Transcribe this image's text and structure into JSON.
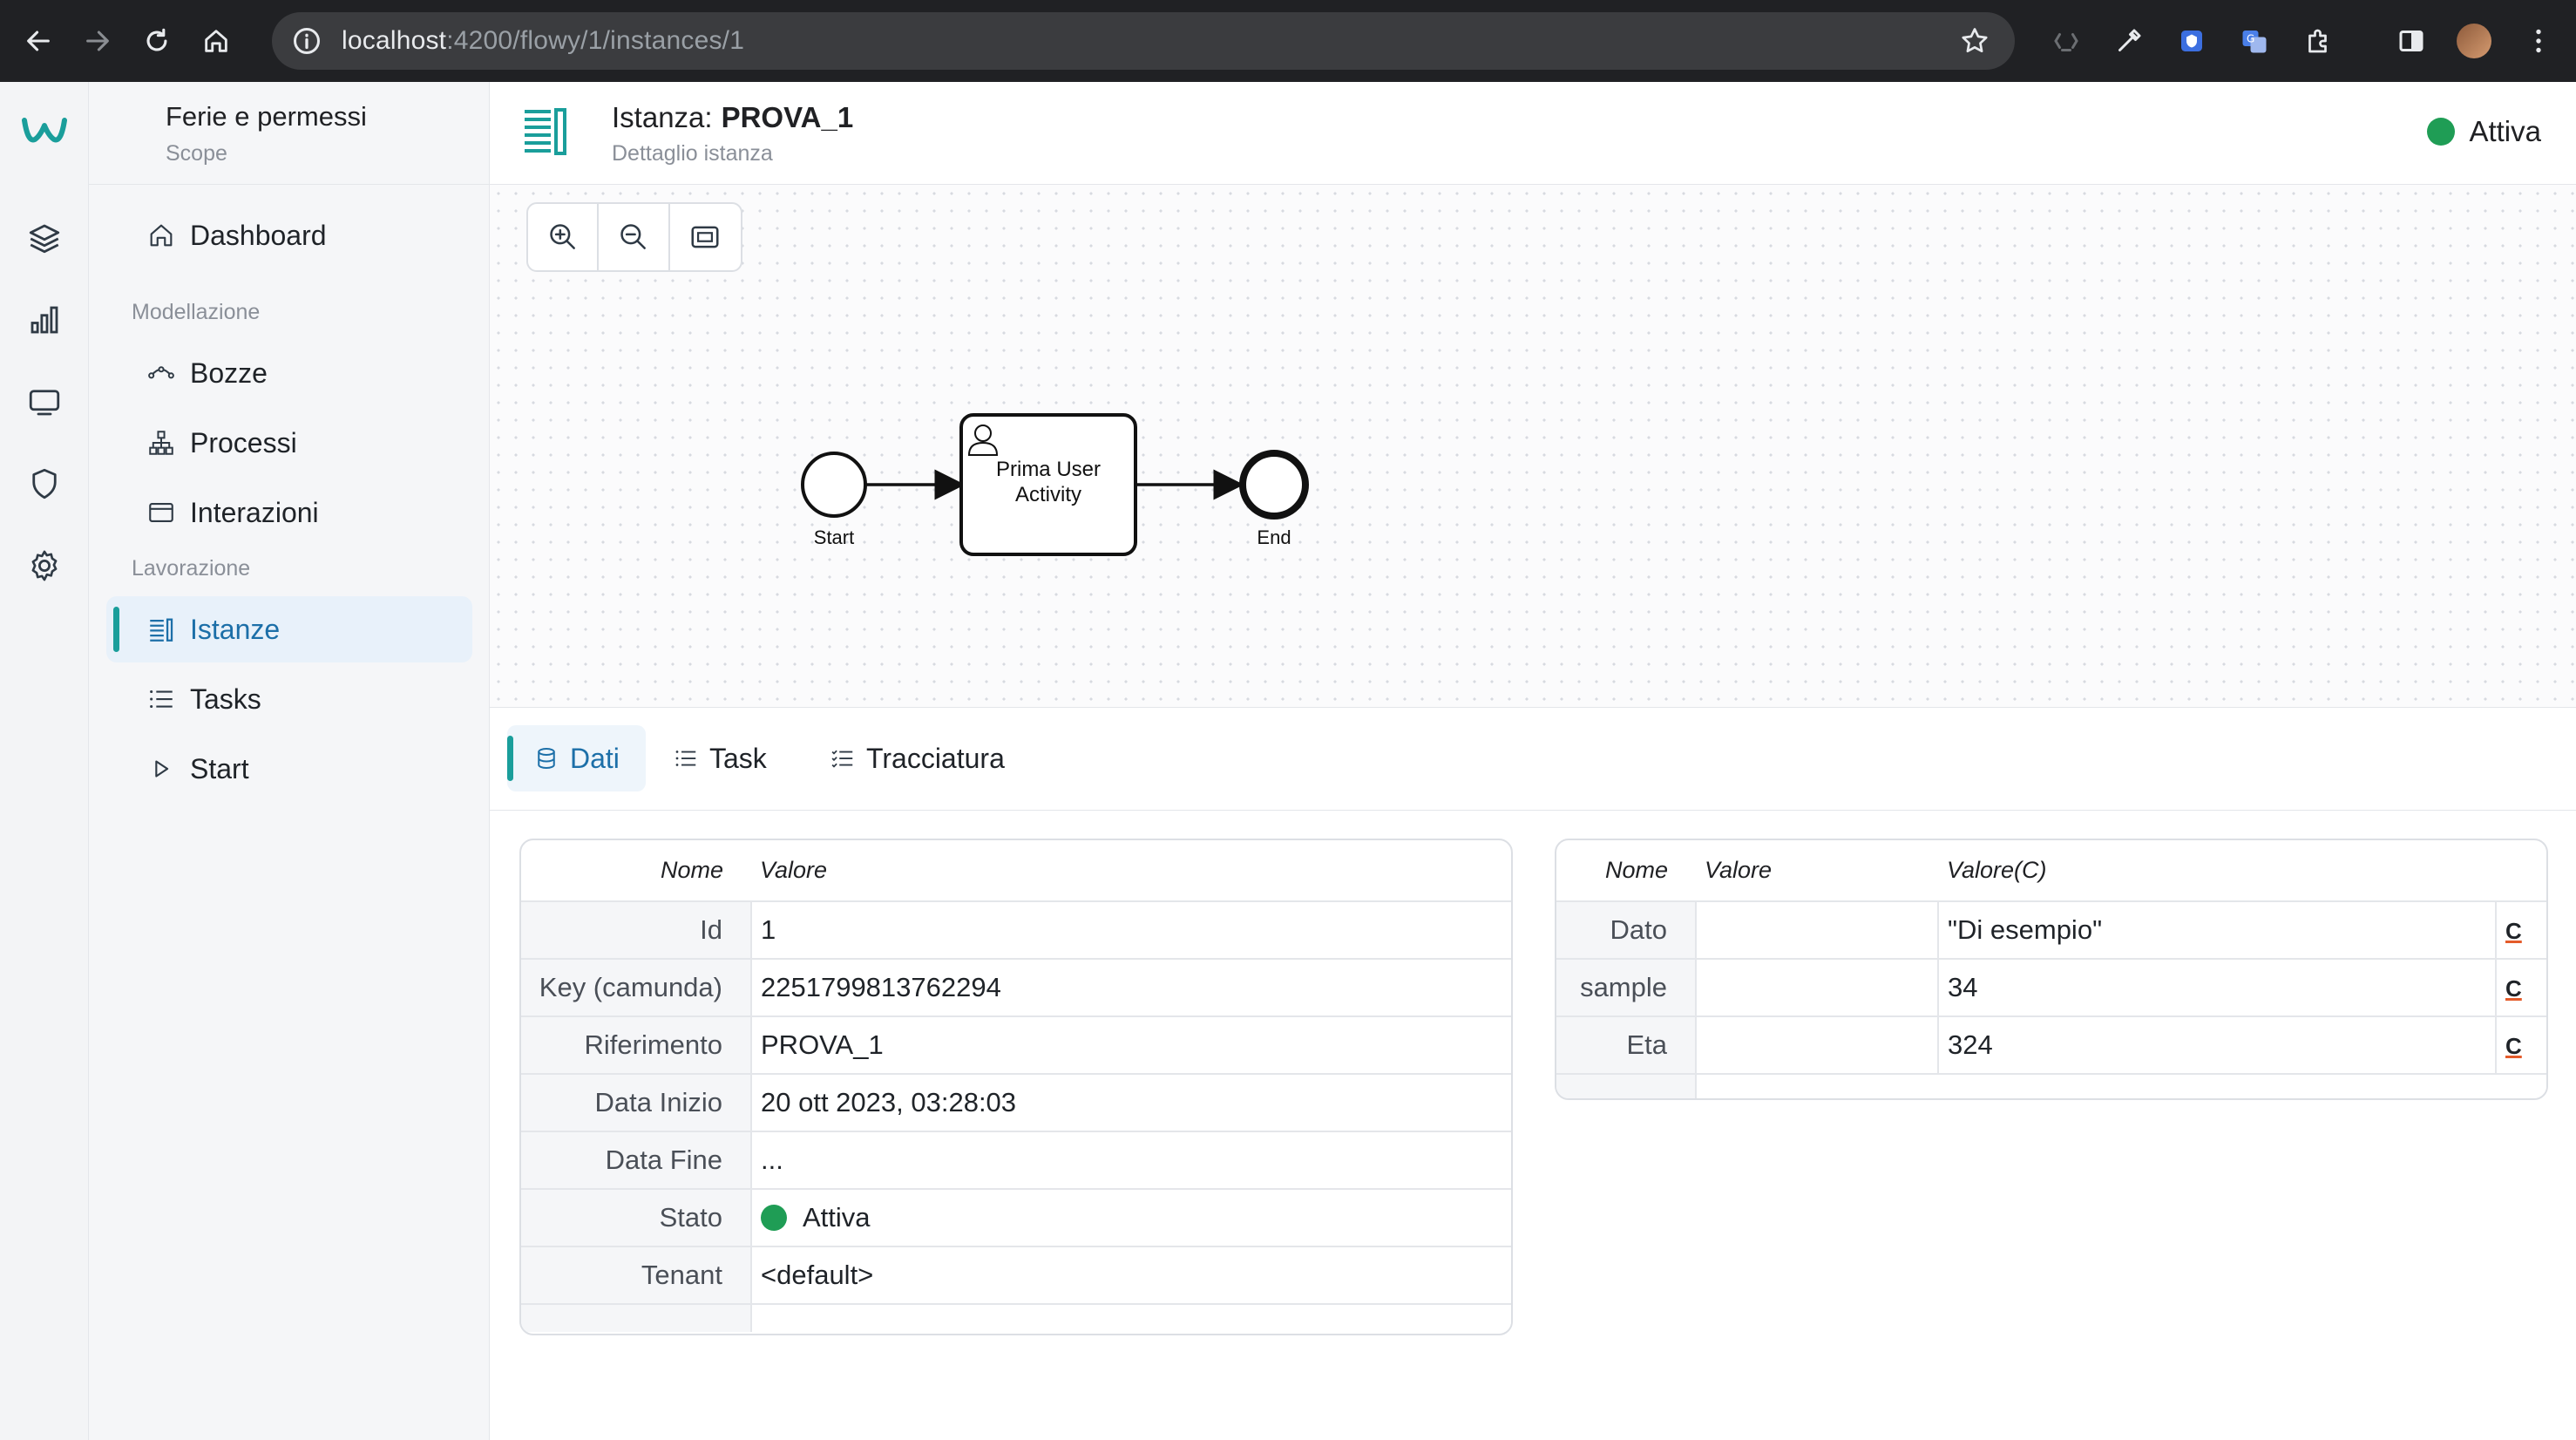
{
  "browser": {
    "url_host": "localhost",
    "url_path": ":4200/flowy/1/instances/1"
  },
  "scope": {
    "title": "Ferie e permessi",
    "subtitle": "Scope"
  },
  "sidebar": {
    "dashboard": "Dashboard",
    "section_modellazione": "Modellazione",
    "bozze": "Bozze",
    "processi": "Processi",
    "interazioni": "Interazioni",
    "section_lavorazione": "Lavorazione",
    "istanze": "Istanze",
    "tasks": "Tasks",
    "start": "Start"
  },
  "header": {
    "title_prefix": "Istanza:",
    "title_name": "PROVA_1",
    "subtitle": "Dettaglio istanza",
    "status": "Attiva",
    "status_color": "#1f9d55"
  },
  "diagram": {
    "start_label": "Start",
    "task_label_line1": "Prima User",
    "task_label_line2": "Activity",
    "end_label": "End"
  },
  "tabs": {
    "dati": "Dati",
    "task": "Task",
    "tracciatura": "Tracciatura"
  },
  "details": {
    "header_name": "Nome",
    "header_value": "Valore",
    "rows": [
      {
        "name": "Id",
        "value": "1"
      },
      {
        "name": "Key (camunda)",
        "value": "2251799813762294"
      },
      {
        "name": "Riferimento",
        "value": "PROVA_1"
      },
      {
        "name": "Data Inizio",
        "value": "20 ott 2023, 03:28:03"
      },
      {
        "name": "Data Fine",
        "value": "..."
      },
      {
        "name": "Stato",
        "value": "Attiva"
      },
      {
        "name": "Tenant",
        "value": "<default>"
      }
    ]
  },
  "variables": {
    "header_name": "Nome",
    "header_value": "Valore",
    "header_value_c": "Valore(C)",
    "action_glyph": "C",
    "rows": [
      {
        "name": "Dato",
        "value": "",
        "value_c": "\"Di esempio\""
      },
      {
        "name": "sample",
        "value": "",
        "value_c": "34"
      },
      {
        "name": "Eta",
        "value": "",
        "value_c": "324"
      }
    ]
  },
  "colors": {
    "accent": "#1a9e9b",
    "active_text": "#1c6fa8",
    "status_green": "#1f9d55"
  }
}
